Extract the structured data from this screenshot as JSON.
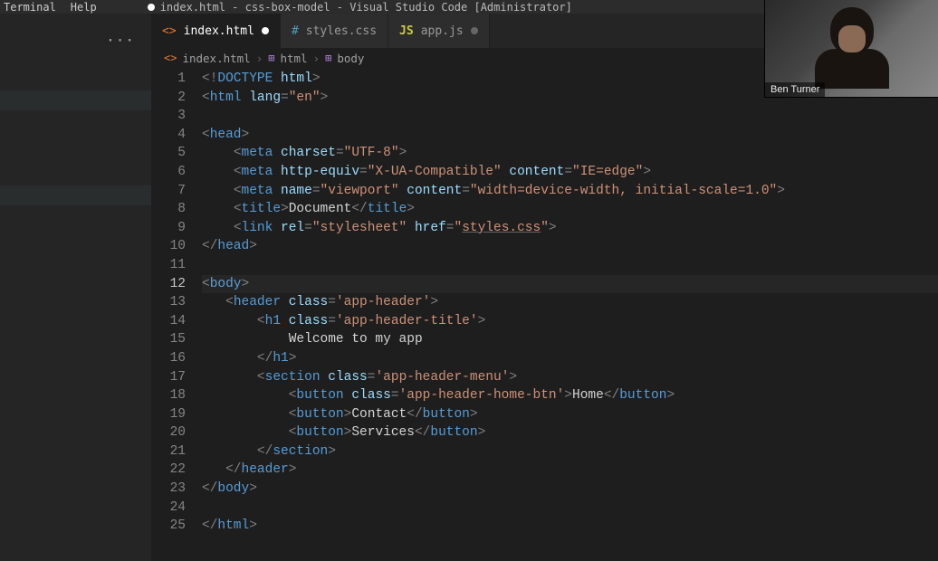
{
  "menubar": {
    "items": [
      "Terminal",
      "Help"
    ],
    "window_title": "index.html - css-box-model - Visual Studio Code [Administrator]"
  },
  "tabs": [
    {
      "icon": "<>",
      "icon_class": "fi-html",
      "label": "index.html",
      "active": true,
      "modified": true
    },
    {
      "icon": "#",
      "icon_class": "fi-css",
      "label": "styles.css",
      "active": false,
      "modified": false
    },
    {
      "icon": "JS",
      "icon_class": "fi-js",
      "label": "app.js",
      "active": false,
      "modified": true,
      "dim": true
    }
  ],
  "breadcrumb": {
    "file_icon": "<>",
    "file": "index.html",
    "segments": [
      {
        "icon": "⊞",
        "label": "html"
      },
      {
        "icon": "⊞",
        "label": "body"
      }
    ]
  },
  "current_line": 12,
  "code_lines": [
    {
      "n": 1,
      "html": "<span class='p'>&lt;!</span><span class='dt'>DOCTYPE</span> <span class='a'>html</span><span class='p'>&gt;</span>"
    },
    {
      "n": 2,
      "html": "<span class='p'>&lt;</span><span class='t'>html</span> <span class='a'>lang</span><span class='p'>=</span><span class='s'>\"en\"</span><span class='p'>&gt;</span>"
    },
    {
      "n": 3,
      "html": ""
    },
    {
      "n": 4,
      "html": "<span class='p'>&lt;</span><span class='t'>head</span><span class='p'>&gt;</span>"
    },
    {
      "n": 5,
      "html": "    <span class='p'>&lt;</span><span class='t'>meta</span> <span class='a'>charset</span><span class='p'>=</span><span class='s'>\"UTF-8\"</span><span class='p'>&gt;</span>"
    },
    {
      "n": 6,
      "html": "    <span class='p'>&lt;</span><span class='t'>meta</span> <span class='a'>http-equiv</span><span class='p'>=</span><span class='s'>\"X-UA-Compatible\"</span> <span class='a'>content</span><span class='p'>=</span><span class='s'>\"IE=edge\"</span><span class='p'>&gt;</span>"
    },
    {
      "n": 7,
      "html": "    <span class='p'>&lt;</span><span class='t'>meta</span> <span class='a'>name</span><span class='p'>=</span><span class='s'>\"viewport\"</span> <span class='a'>content</span><span class='p'>=</span><span class='s'>\"width=device-width, initial-scale=1.0\"</span><span class='p'>&gt;</span>"
    },
    {
      "n": 8,
      "html": "    <span class='p'>&lt;</span><span class='t'>title</span><span class='p'>&gt;</span>Document<span class='p'>&lt;/</span><span class='t'>title</span><span class='p'>&gt;</span>"
    },
    {
      "n": 9,
      "html": "    <span class='p'>&lt;</span><span class='t'>link</span> <span class='a'>rel</span><span class='p'>=</span><span class='s'>\"stylesheet\"</span> <span class='a'>href</span><span class='p'>=</span><span class='s'>\"<span class='ul'>styles.css</span>\"</span><span class='p'>&gt;</span>"
    },
    {
      "n": 10,
      "html": "<span class='p'>&lt;/</span><span class='t'>head</span><span class='p'>&gt;</span>"
    },
    {
      "n": 11,
      "html": ""
    },
    {
      "n": 12,
      "html": "<span class='p'>&lt;</span><span class='t'>body</span><span class='p'>&gt;</span>"
    },
    {
      "n": 13,
      "html": "   <span class='p'>&lt;</span><span class='t'>header</span> <span class='a'>class</span><span class='p'>=</span><span class='s'>'app-header'</span><span class='p'>&gt;</span>"
    },
    {
      "n": 14,
      "html": "       <span class='p'>&lt;</span><span class='t'>h1</span> <span class='a'>class</span><span class='p'>=</span><span class='s'>'app-header-title'</span><span class='p'>&gt;</span>"
    },
    {
      "n": 15,
      "html": "           Welcome to my app"
    },
    {
      "n": 16,
      "html": "       <span class='p'>&lt;/</span><span class='t'>h1</span><span class='p'>&gt;</span>"
    },
    {
      "n": 17,
      "html": "       <span class='p'>&lt;</span><span class='t'>section</span> <span class='a'>class</span><span class='p'>=</span><span class='s'>'app-header-menu'</span><span class='p'>&gt;</span>"
    },
    {
      "n": 18,
      "html": "           <span class='p'>&lt;</span><span class='t'>button</span> <span class='a'>class</span><span class='p'>=</span><span class='s'>'app-header-home-btn'</span><span class='p'>&gt;</span>Home<span class='p'>&lt;/</span><span class='t'>button</span><span class='p'>&gt;</span>"
    },
    {
      "n": 19,
      "html": "           <span class='p'>&lt;</span><span class='t'>button</span><span class='p'>&gt;</span>Contact<span class='p'>&lt;/</span><span class='t'>button</span><span class='p'>&gt;</span>"
    },
    {
      "n": 20,
      "html": "           <span class='p'>&lt;</span><span class='t'>button</span><span class='p'>&gt;</span>Services<span class='p'>&lt;/</span><span class='t'>button</span><span class='p'>&gt;</span>"
    },
    {
      "n": 21,
      "html": "       <span class='p'>&lt;/</span><span class='t'>section</span><span class='p'>&gt;</span>"
    },
    {
      "n": 22,
      "html": "   <span class='p'>&lt;/</span><span class='t'>header</span><span class='p'>&gt;</span>"
    },
    {
      "n": 23,
      "html": "<span class='p'>&lt;/</span><span class='t'>body</span><span class='p'>&gt;</span>"
    },
    {
      "n": 24,
      "html": ""
    },
    {
      "n": 25,
      "html": "<span class='p'>&lt;/</span><span class='t'>html</span><span class='p'>&gt;</span>"
    }
  ],
  "webcam": {
    "name": "Ben Turner"
  }
}
